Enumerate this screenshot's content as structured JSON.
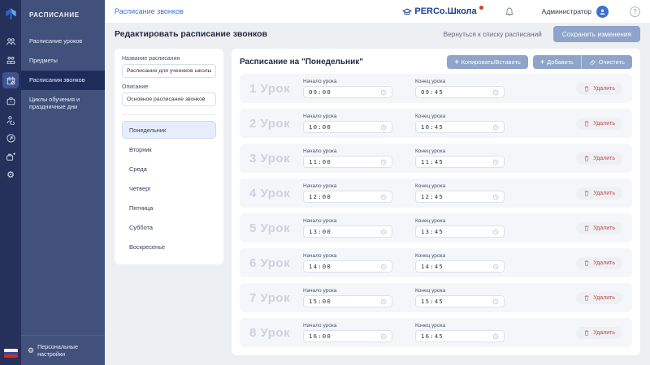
{
  "colors": {
    "rail_bg": "#25315a",
    "sidebar_bg": "#41517c",
    "sidebar_active_bg": "#1d2c59",
    "content_bg": "#edeff3",
    "accent_blue": "#3f72d8",
    "brand_navy": "#1d3f8f",
    "brand_dot_red": "#e03a2f",
    "button_bg": "#8ea4ca",
    "delete_red": "#c14a46",
    "row_bg": "#f5f6f9",
    "lesson_num": "#cdd2dd",
    "day_active_bg": "#e7eefb"
  },
  "rail": {
    "icons": [
      {
        "name": "users-icon",
        "glyph": "users",
        "active": false
      },
      {
        "name": "user-group-icon",
        "glyph": "group",
        "active": false
      },
      {
        "name": "schedule-calendar-icon",
        "glyph": "calendar",
        "active": true
      },
      {
        "name": "badge-icon",
        "glyph": "badge",
        "active": false
      },
      {
        "name": "user-clock-icon",
        "glyph": "userclock",
        "active": false
      },
      {
        "name": "share-arrow-icon",
        "glyph": "share",
        "active": false
      },
      {
        "name": "badge-plus-icon",
        "glyph": "badgeplus",
        "active": false
      }
    ],
    "gear_glyph": "⚙",
    "flag_name": "russia-flag-icon"
  },
  "sidebar": {
    "title": "РАСПИСАНИЕ",
    "items": [
      {
        "label": "Расписание уроков",
        "active": false
      },
      {
        "label": "Предметы",
        "active": false
      },
      {
        "label": "Расписания звонков",
        "active": true
      },
      {
        "label": "Циклы обучения и праздничные дни",
        "active": false
      }
    ],
    "footer_gear": "⚙",
    "footer_label": "Персональные настройки"
  },
  "topbar": {
    "breadcrumb": "Расписание звонков",
    "brand": "PERCo.Школа",
    "user": "Администратор",
    "help": "?"
  },
  "actionbar": {
    "title": "Редактировать расписание звонков",
    "back_label": "Вернуться к списку расписаний",
    "save_label": "Сохранить изменения"
  },
  "form": {
    "name_label": "Название расписания",
    "name_value": "Расписание для учеников школы",
    "desc_label": "Описание",
    "desc_value": "Основное расписание звонков",
    "days": [
      {
        "label": "Понедельник",
        "active": true
      },
      {
        "label": "Вторник",
        "active": false
      },
      {
        "label": "Среда",
        "active": false
      },
      {
        "label": "Четверг",
        "active": false
      },
      {
        "label": "Пятница",
        "active": false
      },
      {
        "label": "Суббота",
        "active": false
      },
      {
        "label": "Воскресенье",
        "active": false
      }
    ]
  },
  "schedule": {
    "heading": "Расписание на \"Понедельник\"",
    "copy_paste_label": "Копировать/Вставить",
    "add_label": "Добавить",
    "clear_label": "Очистить",
    "lesson_word": "Урок",
    "start_label": "Начало урока",
    "end_label": "Конец урока",
    "delete_label": "Удалить",
    "lessons": [
      {
        "n": 1,
        "start": "09:00",
        "end": "09:45"
      },
      {
        "n": 2,
        "start": "10:00",
        "end": "10:45"
      },
      {
        "n": 3,
        "start": "11:00",
        "end": "11:45"
      },
      {
        "n": 4,
        "start": "12:00",
        "end": "12:45"
      },
      {
        "n": 5,
        "start": "13:00",
        "end": "13:45"
      },
      {
        "n": 6,
        "start": "14:00",
        "end": "14:45"
      },
      {
        "n": 7,
        "start": "15:00",
        "end": "15:45"
      },
      {
        "n": 8,
        "start": "16:00",
        "end": "16:45"
      }
    ]
  }
}
